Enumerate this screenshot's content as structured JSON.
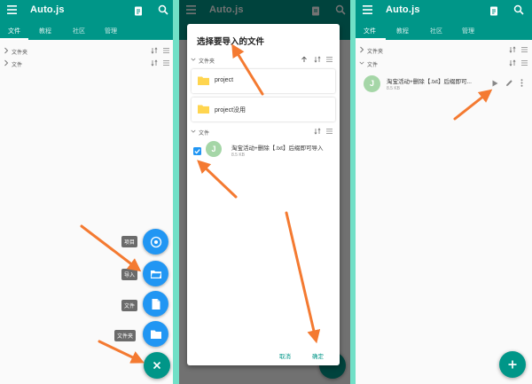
{
  "app": {
    "title": "Auto.js"
  },
  "tabs": [
    "文件",
    "教程",
    "社区",
    "管理"
  ],
  "sections": {
    "folders": "文件夹",
    "files": "文件"
  },
  "fab_menu": [
    {
      "label": "项目",
      "icon": "project-icon"
    },
    {
      "label": "导入",
      "icon": "folder-open-icon"
    },
    {
      "label": "文件",
      "icon": "file-icon"
    },
    {
      "label": "文件夹",
      "icon": "folder-icon"
    }
  ],
  "dialog": {
    "title": "选择要导入的文件",
    "folders": [
      "project",
      "project没用"
    ],
    "file": {
      "initial": "J",
      "name": "淘宝活动+删除【.txt】后缀即可导入",
      "size": "8.5 KB",
      "checked": true
    },
    "cancel_label": "取消",
    "ok_label": "确定"
  },
  "result_file": {
    "initial": "J",
    "name": "淘宝活动+删除【.txt】后缀即可...",
    "size": "8.5 KB"
  },
  "colors": {
    "primary": "#009688",
    "accent": "#2196f3",
    "arrow": "#f47a31",
    "avatar": "#a5d6a7"
  }
}
